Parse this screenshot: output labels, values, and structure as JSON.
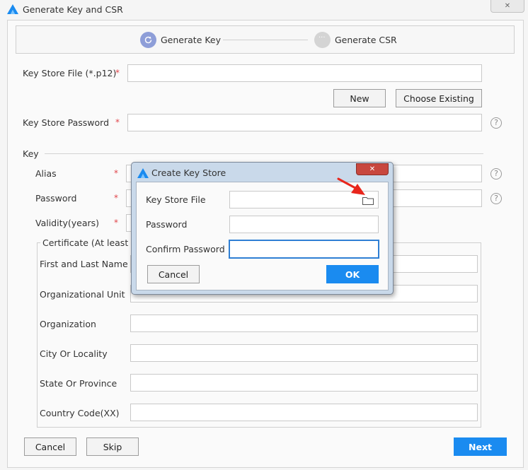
{
  "window": {
    "title": "Generate Key and CSR",
    "close_glyph": "✕"
  },
  "steps": [
    {
      "label": "Generate Key",
      "state": "active"
    },
    {
      "label": "Generate CSR",
      "state": "inactive"
    }
  ],
  "keystore": {
    "file_label": "Key Store File (*.p12)",
    "file_value": "",
    "new_label": "New",
    "choose_label": "Choose Existing",
    "password_label": "Key Store Password",
    "password_value": "",
    "required_mark": "*",
    "help_glyph": "?"
  },
  "key_section": {
    "title": "Key",
    "alias_label": "Alias",
    "password_label": "Password",
    "validity_label": "Validity(years)"
  },
  "certificate": {
    "title": "Certificate (At least on",
    "fields": [
      {
        "label": "First and Last Name",
        "value": ""
      },
      {
        "label": "Organizational Unit",
        "value": ""
      },
      {
        "label": "Organization",
        "value": ""
      },
      {
        "label": "City Or Locality",
        "value": ""
      },
      {
        "label": "State Or Province",
        "value": ""
      },
      {
        "label": "Country Code(XX)",
        "value": ""
      }
    ]
  },
  "footer": {
    "cancel_label": "Cancel",
    "skip_label": "Skip",
    "next_label": "Next"
  },
  "dialog": {
    "title": "Create Key Store",
    "close_glyph": "✕",
    "file_label": "Key Store File",
    "password_label": "Password",
    "confirm_label": "Confirm Password",
    "cancel_label": "Cancel",
    "ok_label": "OK"
  },
  "colors": {
    "accent": "#1a8bf0",
    "required": "#e0454b",
    "dialog_close": "#c8473e",
    "annotation_arrow": "#e8261c"
  }
}
